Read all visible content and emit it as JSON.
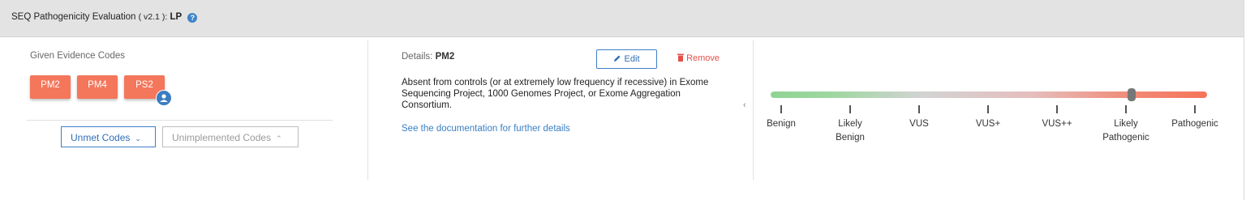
{
  "header": {
    "title": "SEQ Pathogenicity Evaluation",
    "version": "( v2.1 ):",
    "classification": "LP",
    "help_glyph": "?"
  },
  "evidence": {
    "label": "Given Evidence Codes",
    "codes": [
      "PM2",
      "PM4",
      "PS2"
    ],
    "user_badge_icon": "user-icon"
  },
  "dropdowns": {
    "unmet_label": "Unmet Codes",
    "unimplemented_label": "Unimplemented Codes",
    "unmet_chevron": "⌄",
    "unimplemented_chevron": "⌃"
  },
  "details": {
    "label": "Details:",
    "code": "PM2",
    "edit_label": "Edit",
    "remove_label": "Remove",
    "description": "Absent from controls (or at extremely low frequency if recessive) in Exome Sequencing Project, 1000 Genomes Project, or Exome Aggregation Consortium.",
    "doc_link": "See the documentation for further details",
    "collapse_glyph": "‹"
  },
  "scale": {
    "levels": [
      {
        "line1": "Benign",
        "line2": ""
      },
      {
        "line1": "Likely",
        "line2": "Benign"
      },
      {
        "line1": "VUS",
        "line2": ""
      },
      {
        "line1": "VUS+",
        "line2": ""
      },
      {
        "line1": "VUS++",
        "line2": ""
      },
      {
        "line1": "Likely",
        "line2": "Pathogenic"
      },
      {
        "line1": "Pathogenic",
        "line2": ""
      }
    ],
    "selected": "Likely Pathogenic",
    "colors": {
      "benign": "#8fd493",
      "neutral": "#d3d3d3",
      "pathogenic": "#f6735a"
    }
  },
  "colors": {
    "header_bg": "#e3e3e3",
    "code_button": "#f4765b",
    "accent": "#3f7fc6",
    "remove": "#e5504a"
  }
}
